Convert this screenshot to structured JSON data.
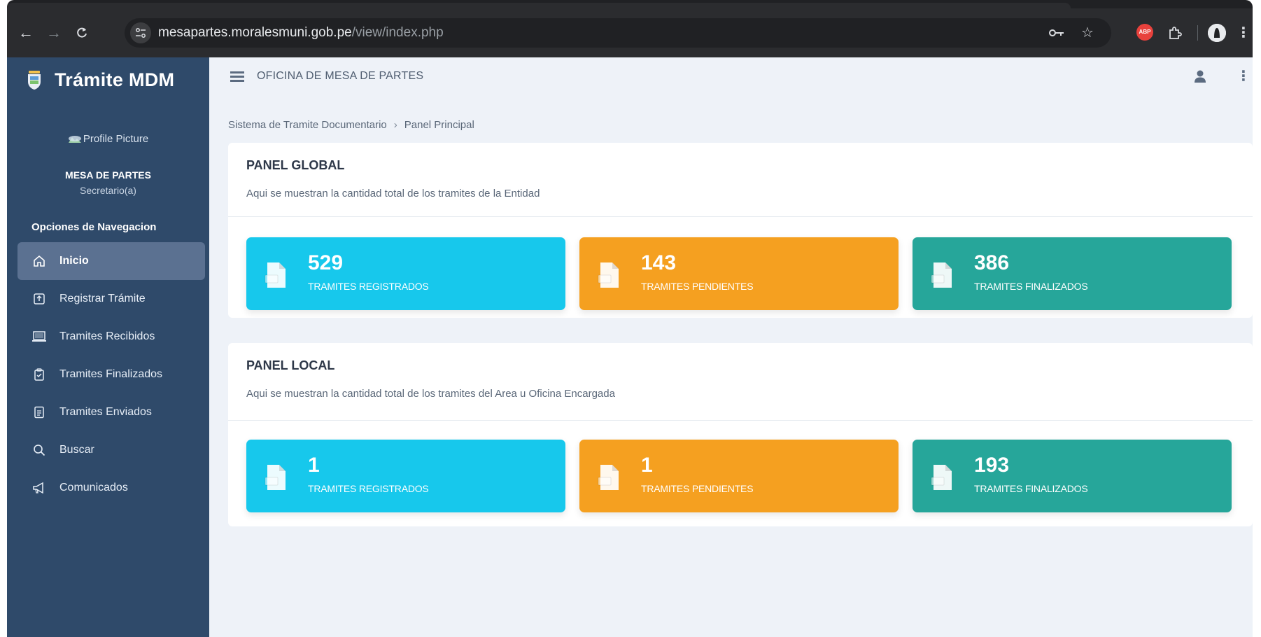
{
  "browser": {
    "url_host": "mesapartes.moralesmuni.gob.pe",
    "url_path": "/view/index.php",
    "extension_badge": "ABP"
  },
  "app": {
    "brand": "Trámite MDM",
    "header_title": "OFICINA DE MESA DE PARTES"
  },
  "user": {
    "profile_picture_alt": "Profile Picture",
    "name": "MESA DE PARTES",
    "role": "Secretario(a)"
  },
  "sidebar": {
    "nav_title": "Opciones de Navegacion",
    "items": [
      {
        "label": "Inicio",
        "icon": "home-icon",
        "active": true
      },
      {
        "label": "Registrar Trámite",
        "icon": "upload-box-icon",
        "active": false
      },
      {
        "label": "Tramites Recibidos",
        "icon": "laptop-icon",
        "active": false
      },
      {
        "label": "Tramites Finalizados",
        "icon": "clipboard-check-icon",
        "active": false
      },
      {
        "label": "Tramites Enviados",
        "icon": "document-icon",
        "active": false
      },
      {
        "label": "Buscar",
        "icon": "search-icon",
        "active": false
      },
      {
        "label": "Comunicados",
        "icon": "megaphone-icon",
        "active": false
      }
    ]
  },
  "breadcrumb": {
    "root": "Sistema de Tramite Documentario",
    "separator": "›",
    "current": "Panel Principal"
  },
  "panels": {
    "global": {
      "title": "PANEL GLOBAL",
      "description": "Aqui se muestran la cantidad total de los tramites de la Entidad",
      "cards": [
        {
          "count": "529",
          "label": "TRAMITES REGISTRADOS",
          "color": "#17c8ec"
        },
        {
          "count": "143",
          "label": "TRAMITES PENDIENTES",
          "color": "#f5a020"
        },
        {
          "count": "386",
          "label": "TRAMITES FINALIZADOS",
          "color": "#26a69a"
        }
      ]
    },
    "local": {
      "title": "PANEL LOCAL",
      "description": "Aqui se muestran la cantidad total de los tramites del Area u Oficina Encargada",
      "cards": [
        {
          "count": "1",
          "label": "TRAMITES REGISTRADOS",
          "color": "#17c8ec"
        },
        {
          "count": "1",
          "label": "TRAMITES PENDIENTES",
          "color": "#f5a020"
        },
        {
          "count": "193",
          "label": "TRAMITES FINALIZADOS",
          "color": "#26a69a"
        }
      ]
    }
  },
  "theme": {
    "sidebar_bg": "#2f4a6a",
    "sidebar_active": "#5b7191",
    "content_bg": "#eef2f8"
  }
}
